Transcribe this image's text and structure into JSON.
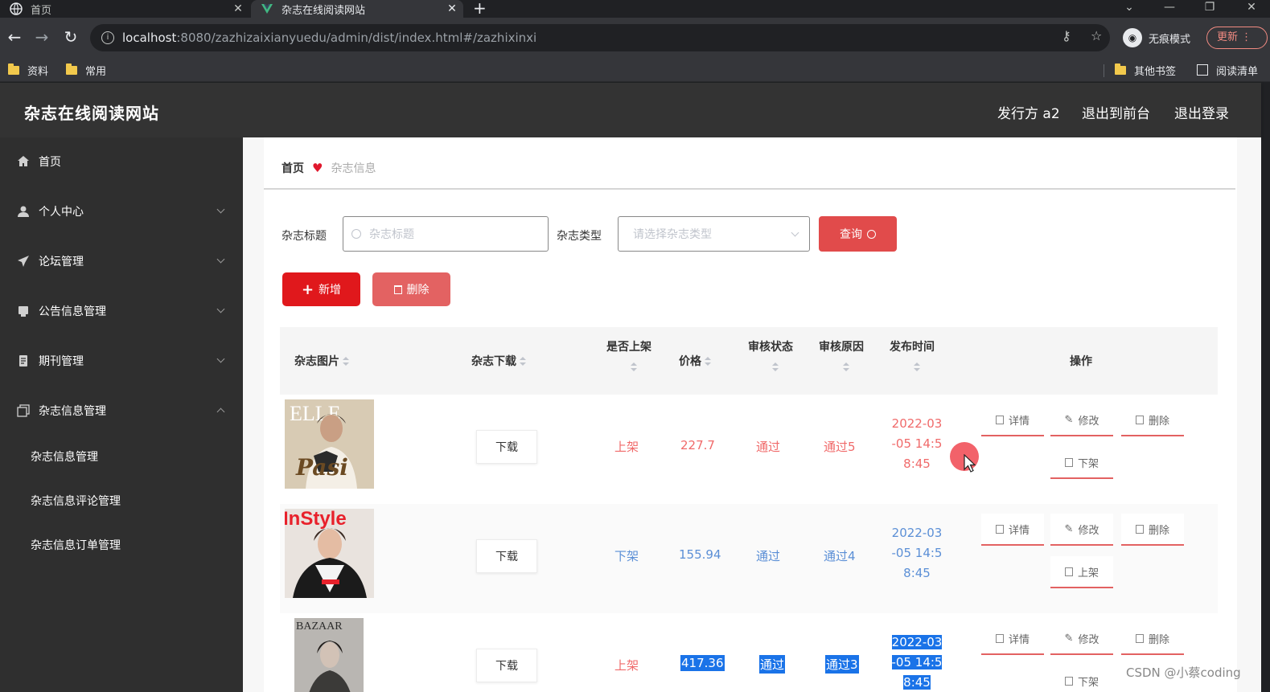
{
  "browser": {
    "tabs": [
      {
        "title": "首页",
        "active": false
      },
      {
        "title": "杂志在线阅读网站",
        "active": true
      }
    ],
    "url_host": "localhost",
    "url_rest": ":8080/zazhizaixianyuedu/admin/dist/index.html#/zazhixinxi",
    "incognito_label": "无痕模式",
    "update_label": "更新",
    "bookmarks": [
      "资料",
      "常用"
    ],
    "other_bookmarks": "其他书签",
    "reading_list": "阅读清单"
  },
  "header": {
    "title": "杂志在线阅读网站",
    "publisher": "发行方 a2",
    "to_front": "退出到前台",
    "logout": "退出登录"
  },
  "sidebar": {
    "items": [
      {
        "label": "首页",
        "icon": "home-icon"
      },
      {
        "label": "个人中心",
        "icon": "user-icon"
      },
      {
        "label": "论坛管理",
        "icon": "send-icon"
      },
      {
        "label": "公告信息管理",
        "icon": "notice-icon"
      },
      {
        "label": "期刊管理",
        "icon": "journal-icon"
      },
      {
        "label": "杂志信息管理",
        "icon": "copy-icon"
      }
    ],
    "sub_items": [
      "杂志信息管理",
      "杂志信息评论管理",
      "杂志信息订单管理"
    ]
  },
  "breadcrumb": {
    "home": "首页",
    "current": "杂志信息"
  },
  "search": {
    "title_label": "杂志标题",
    "title_placeholder": "杂志标题",
    "type_label": "杂志类型",
    "type_placeholder": "请选择杂志类型",
    "query_label": "查询"
  },
  "actions": {
    "add": "新增",
    "delete": "删除"
  },
  "table": {
    "headers": [
      "杂志图片",
      "杂志下载",
      "是否上架",
      "价格",
      "审核状态",
      "审核原因",
      "发布时间",
      "操作"
    ],
    "rows": [
      {
        "download": "下载",
        "shelf": "上架",
        "price": "227.7",
        "status": "通过",
        "reason": "通过5",
        "date_lines": [
          "2022-03",
          "-05 14:5",
          "8:45"
        ],
        "toggle": "下架",
        "cover_text": "Pasi"
      },
      {
        "download": "下载",
        "shelf": "下架",
        "price": "155.94",
        "status": "通过",
        "reason": "通过4",
        "date_lines": [
          "2022-03",
          "-05 14:5",
          "8:45"
        ],
        "toggle": "上架",
        "cover_text": "InStyle"
      },
      {
        "download": "下载",
        "shelf": "上架",
        "price": "417.36",
        "status": "通过",
        "reason": "通过3",
        "date_lines": [
          "2022-03",
          "-05 14:5",
          "8:45"
        ],
        "toggle": "下架",
        "cover_text": "BAZAAR"
      }
    ],
    "ops": {
      "detail": "详情",
      "edit": "修改",
      "delete": "删除"
    }
  },
  "watermark": "CSDN @小蔡coding",
  "colors": {
    "accent": "#e0181c",
    "header_bg": "#333333",
    "sidebar_bg": "#2f2f2f",
    "status_red": "#f06a6a",
    "status_blue": "#5b8fd6"
  }
}
